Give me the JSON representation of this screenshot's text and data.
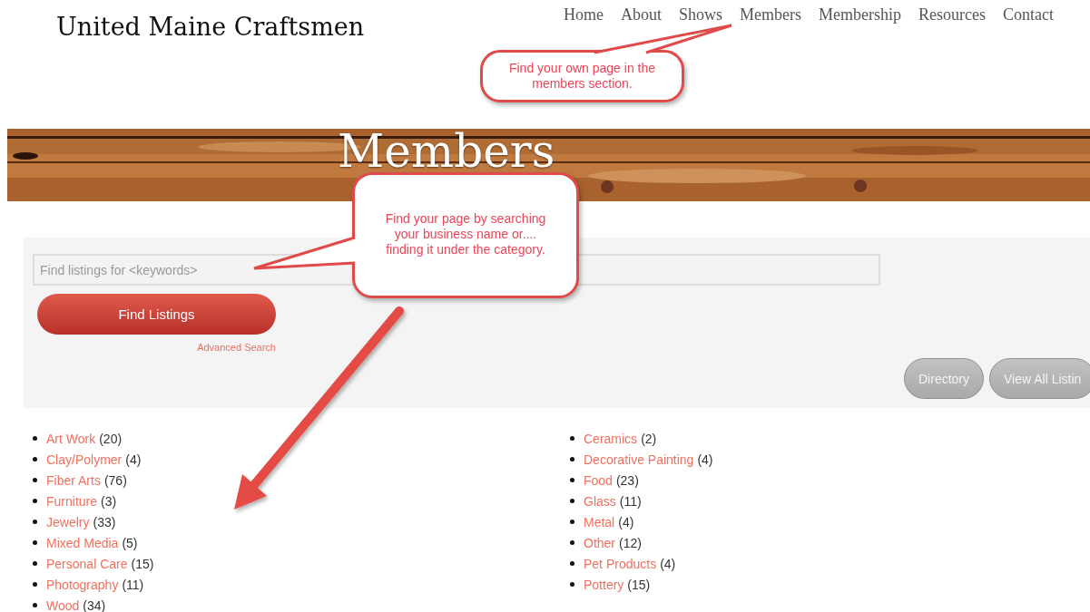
{
  "site": {
    "title": "United Maine Craftsmen"
  },
  "nav": [
    {
      "label": "Home"
    },
    {
      "label": "About"
    },
    {
      "label": "Shows"
    },
    {
      "label": "Members"
    },
    {
      "label": "Membership"
    },
    {
      "label": "Resources"
    },
    {
      "label": "Contact"
    }
  ],
  "banner": {
    "title": "Members"
  },
  "search": {
    "placeholder": "Find listings for <keywords>",
    "button": "Find Listings",
    "advanced_link": "Advanced Search",
    "view_buttons": [
      "Directory",
      "View All Listin"
    ]
  },
  "categories": {
    "left": [
      {
        "name": "Art Work",
        "count": "(20)"
      },
      {
        "name": "Clay/Polymer",
        "count": "(4)"
      },
      {
        "name": "Fiber Arts",
        "count": "(76)"
      },
      {
        "name": "Furniture",
        "count": "(3)"
      },
      {
        "name": "Jewelry",
        "count": "(33)"
      },
      {
        "name": "Mixed Media",
        "count": "(5)"
      },
      {
        "name": "Personal Care",
        "count": "(15)"
      },
      {
        "name": "Photography",
        "count": "(11)"
      },
      {
        "name": "Wood",
        "count": "(34)"
      }
    ],
    "right": [
      {
        "name": "Ceramics",
        "count": "(2)"
      },
      {
        "name": "Decorative Painting",
        "count": "(4)"
      },
      {
        "name": "Food",
        "count": "(23)"
      },
      {
        "name": "Glass",
        "count": "(11)"
      },
      {
        "name": "Metal",
        "count": "(4)"
      },
      {
        "name": "Other",
        "count": "(12)"
      },
      {
        "name": "Pet Products",
        "count": "(4)"
      },
      {
        "name": "Pottery",
        "count": "(15)"
      }
    ]
  },
  "annotations": [
    {
      "text": "Find your own page in the members section."
    },
    {
      "text": "Find your page by searching your business name or.... finding it under the category."
    }
  ]
}
